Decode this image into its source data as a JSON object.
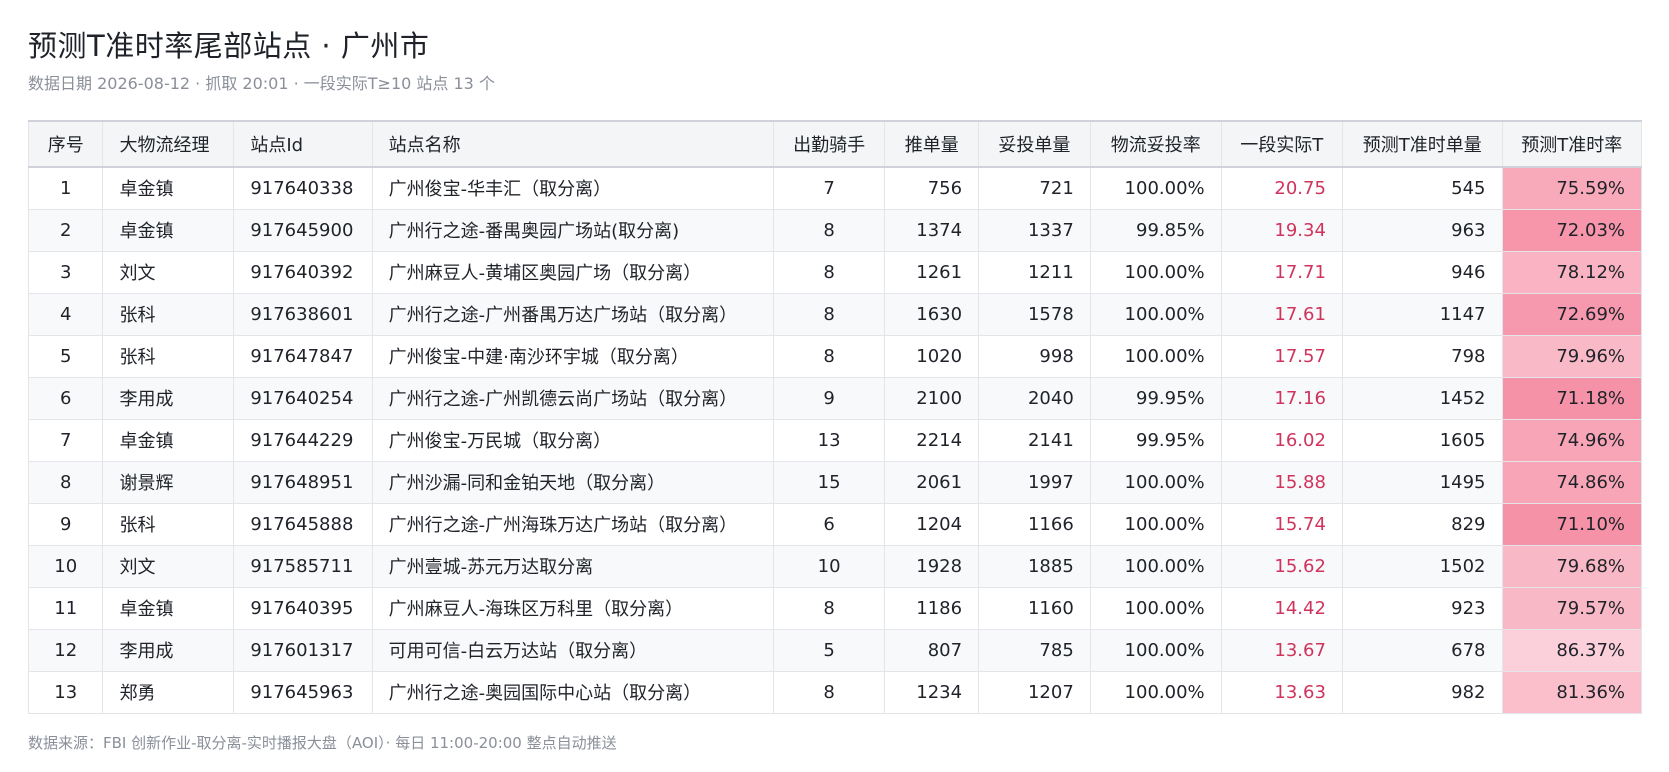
{
  "header": {
    "title": "预测T准时率尾部站点 · 广州市",
    "subtitle": "数据日期 2026-08-12 · 抓取 20:01 · 一段实际T≥10 站点 13 个"
  },
  "table": {
    "columns": [
      "序号",
      "大物流经理",
      "站点Id",
      "站点名称",
      "出勤骑手",
      "推单量",
      "妥投单量",
      "物流妥投率",
      "一段实际T",
      "预测T准时单量",
      "预测T准时率"
    ],
    "rows": [
      {
        "idx": "1",
        "manager": "卓金镇",
        "site_id": "917640338",
        "site_name": "广州俊宝-华丰汇（取分离）",
        "riders": "7",
        "push": "756",
        "delivered": "721",
        "delivery_rate": "100.00%",
        "t1": "20.75",
        "ontime_cnt": "545",
        "ontime_rate": "75.59%",
        "ontime_color": "#f8a9ba"
      },
      {
        "idx": "2",
        "manager": "卓金镇",
        "site_id": "917645900",
        "site_name": "广州行之途-番禺奥园广场站(取分离)",
        "riders": "8",
        "push": "1374",
        "delivered": "1337",
        "delivery_rate": "99.85%",
        "t1": "19.34",
        "ontime_cnt": "963",
        "ontime_rate": "72.03%",
        "ontime_color": "#f795ab"
      },
      {
        "idx": "3",
        "manager": "刘文",
        "site_id": "917640392",
        "site_name": "广州麻豆人-黄埔区奥园广场（取分离）",
        "riders": "8",
        "push": "1261",
        "delivered": "1211",
        "delivery_rate": "100.00%",
        "t1": "17.71",
        "ontime_cnt": "946",
        "ontime_rate": "78.12%",
        "ontime_color": "#f9b3c2"
      },
      {
        "idx": "4",
        "manager": "张科",
        "site_id": "917638601",
        "site_name": "广州行之途-广州番禺万达广场站（取分离）",
        "riders": "8",
        "push": "1630",
        "delivered": "1578",
        "delivery_rate": "100.00%",
        "t1": "17.61",
        "ontime_cnt": "1147",
        "ontime_rate": "72.69%",
        "ontime_color": "#f799ae"
      },
      {
        "idx": "5",
        "manager": "张科",
        "site_id": "917647847",
        "site_name": "广州俊宝-中建·南沙环宇城（取分离）",
        "riders": "8",
        "push": "1020",
        "delivered": "998",
        "delivery_rate": "100.00%",
        "t1": "17.57",
        "ontime_cnt": "798",
        "ontime_rate": "79.96%",
        "ontime_color": "#f9b9c6"
      },
      {
        "idx": "6",
        "manager": "李用成",
        "site_id": "917640254",
        "site_name": "广州行之途-广州凯德云尚广场站（取分离）",
        "riders": "9",
        "push": "2100",
        "delivered": "2040",
        "delivery_rate": "99.95%",
        "t1": "17.16",
        "ontime_cnt": "1452",
        "ontime_rate": "71.18%",
        "ontime_color": "#f692a8"
      },
      {
        "idx": "7",
        "manager": "卓金镇",
        "site_id": "917644229",
        "site_name": "广州俊宝-万民城（取分离）",
        "riders": "13",
        "push": "2214",
        "delivered": "2141",
        "delivery_rate": "99.95%",
        "t1": "16.02",
        "ontime_cnt": "1605",
        "ontime_rate": "74.96%",
        "ontime_color": "#f8a5b7"
      },
      {
        "idx": "8",
        "manager": "谢景辉",
        "site_id": "917648951",
        "site_name": "广州沙漏-同和金铂天地（取分离）",
        "riders": "15",
        "push": "2061",
        "delivered": "1997",
        "delivery_rate": "100.00%",
        "t1": "15.88",
        "ontime_cnt": "1495",
        "ontime_rate": "74.86%",
        "ontime_color": "#f8a5b7"
      },
      {
        "idx": "9",
        "manager": "张科",
        "site_id": "917645888",
        "site_name": "广州行之途-广州海珠万达广场站（取分离）",
        "riders": "6",
        "push": "1204",
        "delivered": "1166",
        "delivery_rate": "100.00%",
        "t1": "15.74",
        "ontime_cnt": "829",
        "ontime_rate": "71.10%",
        "ontime_color": "#f692a8"
      },
      {
        "idx": "10",
        "manager": "刘文",
        "site_id": "917585711",
        "site_name": "广州壹城-苏元万达取分离",
        "riders": "10",
        "push": "1928",
        "delivered": "1885",
        "delivery_rate": "100.00%",
        "t1": "15.62",
        "ontime_cnt": "1502",
        "ontime_rate": "79.68%",
        "ontime_color": "#f9b8c5"
      },
      {
        "idx": "11",
        "manager": "卓金镇",
        "site_id": "917640395",
        "site_name": "广州麻豆人-海珠区万科里（取分离）",
        "riders": "8",
        "push": "1186",
        "delivered": "1160",
        "delivery_rate": "100.00%",
        "t1": "14.42",
        "ontime_cnt": "923",
        "ontime_rate": "79.57%",
        "ontime_color": "#f9b8c5"
      },
      {
        "idx": "12",
        "manager": "李用成",
        "site_id": "917601317",
        "site_name": "可用可信-白云万达站（取分离）",
        "riders": "5",
        "push": "807",
        "delivered": "785",
        "delivery_rate": "100.00%",
        "t1": "13.67",
        "ontime_cnt": "678",
        "ontime_rate": "86.37%",
        "ontime_color": "#fbd0da"
      },
      {
        "idx": "13",
        "manager": "郑勇",
        "site_id": "917645963",
        "site_name": "广州行之途-奥园国际中心站（取分离）",
        "riders": "8",
        "push": "1234",
        "delivered": "1207",
        "delivery_rate": "100.00%",
        "t1": "13.63",
        "ontime_cnt": "982",
        "ontime_rate": "81.36%",
        "ontime_color": "#fabfcb"
      }
    ]
  },
  "footer": "数据来源：FBI 创新作业-取分离-实时播报大盘（AOI）· 每日 11:00-20:00 整点自动推送"
}
